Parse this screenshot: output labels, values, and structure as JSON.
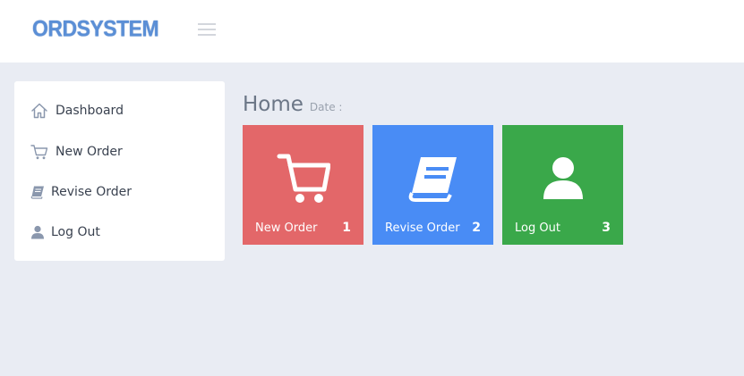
{
  "header": {
    "logo_text": "ORDSYSTEM",
    "logo_color": "#5b8fd6",
    "menu_icon": "hamburger-menu-icon"
  },
  "sidebar": {
    "items": [
      {
        "label": "Dashboard",
        "icon": "home-icon"
      },
      {
        "label": "New Order",
        "icon": "cart-icon"
      },
      {
        "label": "Revise Order",
        "icon": "book-icon"
      },
      {
        "label": "Log Out",
        "icon": "user-icon"
      }
    ]
  },
  "main": {
    "title": "Home",
    "subtitle": "Date :",
    "tiles": [
      {
        "label": "New Order",
        "count": "1",
        "color": "#e36769",
        "icon": "cart-icon"
      },
      {
        "label": "Revise Order",
        "count": "2",
        "color": "#498cf5",
        "icon": "book-icon"
      },
      {
        "label": "Log Out",
        "count": "3",
        "color": "#3aa84a",
        "icon": "user-icon"
      }
    ]
  },
  "colors": {
    "content_background": "#e9ecf3",
    "sidebar_icon": "#8a97ad",
    "title": "#6b7686"
  }
}
